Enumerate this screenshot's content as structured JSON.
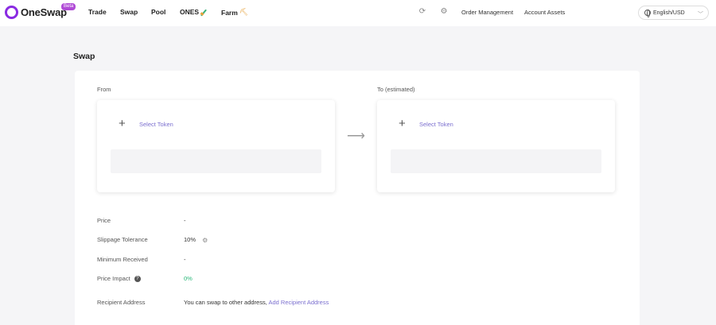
{
  "header": {
    "logo_text": "OneSwap",
    "beta_badge": "Beta",
    "nav": {
      "trade": "Trade",
      "swap": "Swap",
      "pool": "Pool",
      "ones": "ONES",
      "farm": "Farm"
    },
    "order_management": "Order Management",
    "account_assets": "Account Assets",
    "language": "English/USD"
  },
  "page": {
    "title": "Swap"
  },
  "swap": {
    "from_label": "From",
    "to_label": "To (estimated)",
    "from_select": "Select Token",
    "to_select": "Select Token"
  },
  "details": {
    "price_label": "Price",
    "price_value": "-",
    "slippage_label": "Slippage Tolerance",
    "slippage_value": "10%",
    "min_received_label": "Minimum Received",
    "min_received_value": "-",
    "price_impact_label": "Price Impact",
    "price_impact_value": "0%",
    "recipient_label": "Recipient Address",
    "recipient_text": "You can swap to other address, ",
    "recipient_link": "Add Recipient Address"
  },
  "colors": {
    "accent": "#7b6fcf",
    "brand": "#8a2be2",
    "positive": "#2cb87a"
  }
}
